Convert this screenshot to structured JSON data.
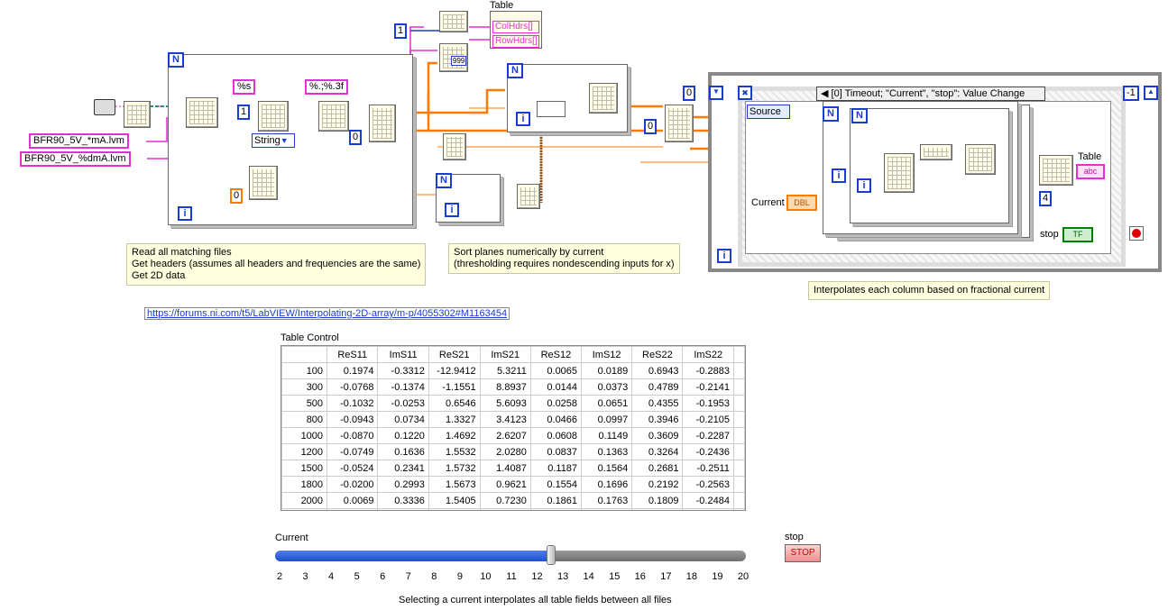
{
  "file_patterns": [
    "BFR90_5V_*mA.lvm",
    "BFR90_5V_%dmA.lvm"
  ],
  "format_constants": [
    "%s",
    "%.;%.3f"
  ],
  "string_selector": "String",
  "table_indicator_title": "Table",
  "table_indicator_props": [
    "ColHdrs[]",
    "RowHdrs[]"
  ],
  "const_values": {
    "one_a": "1",
    "one_b": "1",
    "zero_a": "0",
    "zero_b": "0",
    "zero_c": "0",
    "zero_d": "0",
    "dbl_zero": "0",
    "four": "4",
    "minus_one": "-1",
    "timeout_pad": "999"
  },
  "event_case_label": "[0] Timeout;  \"Current\", \"stop\": Value Change",
  "source_label": "Source",
  "current_label": "Current",
  "dbl_tag": "DBL",
  "stop_label": "stop",
  "tf_tag": "TF",
  "table_out_label": "Table",
  "abc_tag": "abc",
  "loop_n": "N",
  "loop_i": "i",
  "notes": {
    "read_files": "Read all matching files\nGet headers (assumes all headers and frequencies are the same)\nGet 2D data",
    "sort": "Sort planes numerically by current\n(thresholding requires nondescending inputs for x)",
    "interp": "Interpolates each column based on fractional current"
  },
  "link": "https://forums.ni.com/t5/LabVIEW/Interpolating-2D-array/m-p/4055302#M1163454",
  "table_control": {
    "label": "Table Control",
    "columns": [
      "ReS11",
      "ImS11",
      "ReS21",
      "ImS21",
      "ReS12",
      "ImS12",
      "ReS22",
      "ImS22"
    ],
    "rows": [
      {
        "hdr": "100",
        "vals": [
          "0.1974",
          "-0.3312",
          "-12.9412",
          "5.3211",
          "0.0065",
          "0.0189",
          "0.6943",
          "-0.2883"
        ]
      },
      {
        "hdr": "300",
        "vals": [
          "-0.0768",
          "-0.1374",
          "-1.1551",
          "8.8937",
          "0.0144",
          "0.0373",
          "0.4789",
          "-0.2141"
        ]
      },
      {
        "hdr": "500",
        "vals": [
          "-0.1032",
          "-0.0253",
          "0.6546",
          "5.6093",
          "0.0258",
          "0.0651",
          "0.4355",
          "-0.1953"
        ]
      },
      {
        "hdr": "800",
        "vals": [
          "-0.0943",
          "0.0734",
          "1.3327",
          "3.4123",
          "0.0466",
          "0.0997",
          "0.3946",
          "-0.2105"
        ]
      },
      {
        "hdr": "1000",
        "vals": [
          "-0.0870",
          "0.1220",
          "1.4692",
          "2.6207",
          "0.0608",
          "0.1149",
          "0.3609",
          "-0.2287"
        ]
      },
      {
        "hdr": "1200",
        "vals": [
          "-0.0749",
          "0.1636",
          "1.5532",
          "2.0280",
          "0.0837",
          "0.1363",
          "0.3264",
          "-0.2436"
        ]
      },
      {
        "hdr": "1500",
        "vals": [
          "-0.0524",
          "0.2341",
          "1.5732",
          "1.4087",
          "0.1187",
          "0.1564",
          "0.2681",
          "-0.2511"
        ]
      },
      {
        "hdr": "1800",
        "vals": [
          "-0.0200",
          "0.2993",
          "1.5673",
          "0.9621",
          "0.1554",
          "0.1696",
          "0.2192",
          "-0.2563"
        ]
      },
      {
        "hdr": "2000",
        "vals": [
          "0.0069",
          "0.3336",
          "1.5405",
          "0.7230",
          "0.1861",
          "0.1763",
          "0.1809",
          "-0.2484"
        ]
      }
    ]
  },
  "slider": {
    "label": "Current",
    "ticks": [
      "2",
      "3",
      "4",
      "5",
      "6",
      "7",
      "8",
      "9",
      "10",
      "11",
      "12",
      "13",
      "14",
      "15",
      "16",
      "17",
      "18",
      "19",
      "20"
    ],
    "min": 2,
    "max": 20,
    "value": 12.5
  },
  "stop_control": {
    "label": "stop",
    "button": "STOP"
  },
  "footer_caption": "Selecting a current interpolates all table fields between all files",
  "colors": {
    "int_wire": "#1a3ccf",
    "dbl_wire": "#ff7a00",
    "str_wire": "#e42fd2",
    "bool_wire": "#008000",
    "note_bg": "#ffffdf",
    "slider_fill": "#2a5bd7"
  }
}
